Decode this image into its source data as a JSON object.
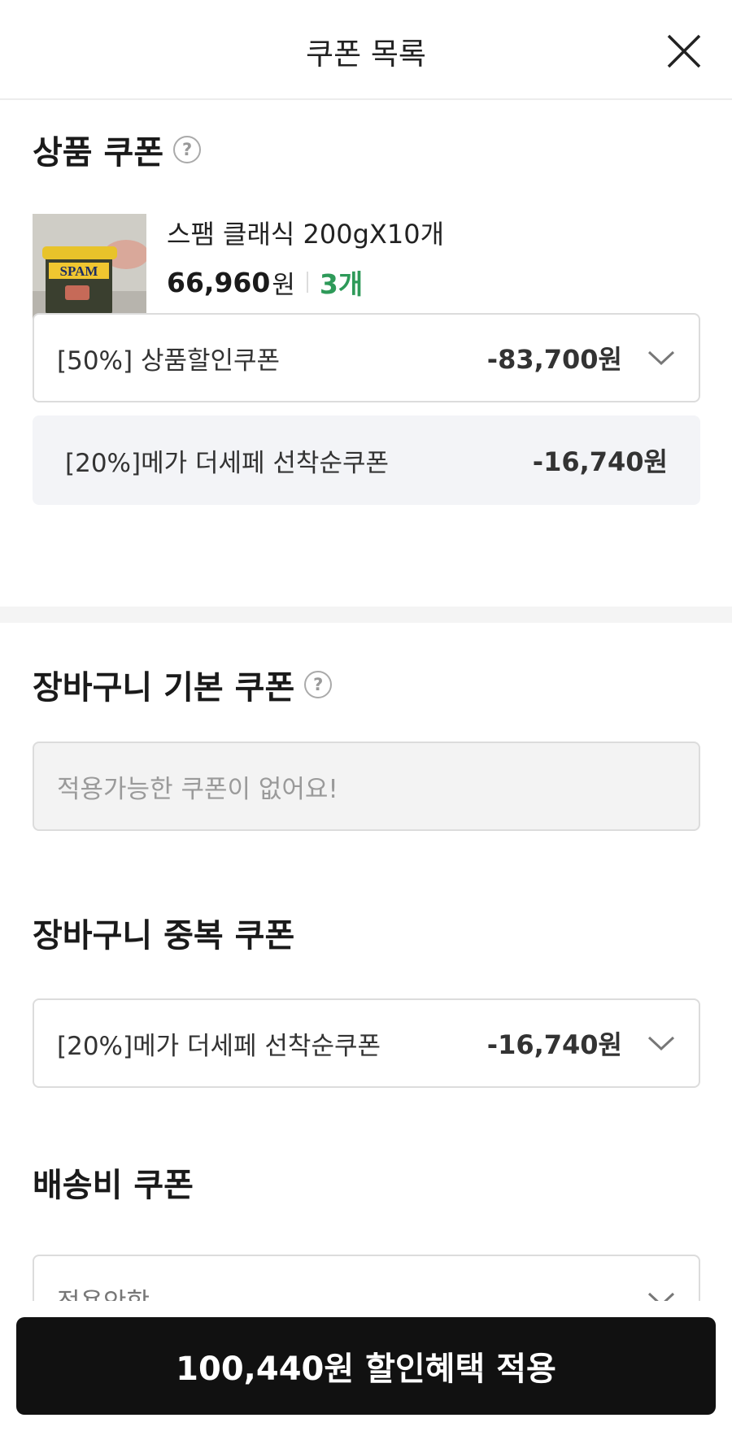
{
  "header": {
    "title": "쿠폰 목록",
    "close_icon": "close-icon"
  },
  "product_coupon": {
    "title": "상품 쿠폰",
    "help": "?",
    "product": {
      "name": "스팸 클래식 200gX10개",
      "price": "66,960",
      "currency": "원",
      "quantity": "3개",
      "thumb_label": "SPAM"
    },
    "selected": {
      "label": "[50%] 상품할인쿠폰",
      "amount": "-83,700원"
    },
    "applied": {
      "label": "[20%]메가 더세페 선착순쿠폰",
      "amount": "-16,740원"
    }
  },
  "cart_basic_coupon": {
    "title": "장바구니 기본 쿠폰",
    "help": "?",
    "empty_text": "적용가능한 쿠폰이 없어요!"
  },
  "cart_stack_coupon": {
    "title": "장바구니 중복 쿠폰",
    "selected": {
      "label": "[20%]메가 더세페 선착순쿠폰",
      "amount": "-16,740원"
    }
  },
  "shipping_coupon": {
    "title": "배송비 쿠폰",
    "selected": {
      "label": "적용안함"
    }
  },
  "cta": {
    "label": "100,440원 할인혜택 적용"
  },
  "colors": {
    "accent_green": "#2e9a59",
    "cta_bg": "#111111"
  }
}
